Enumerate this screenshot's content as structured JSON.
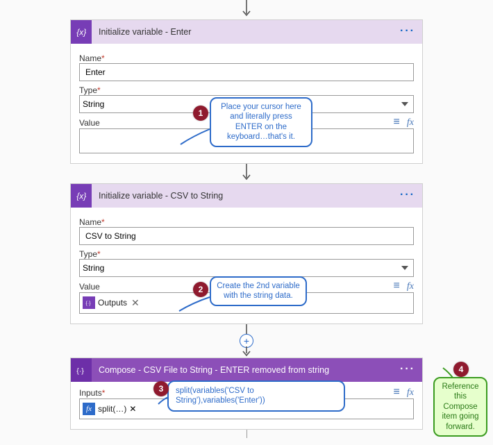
{
  "arrows": {
    "down": "↓"
  },
  "card1": {
    "title": "Initialize variable - Enter",
    "menu": "···",
    "name_label": "Name",
    "name_value": "Enter",
    "type_label": "Type",
    "type_value": "String",
    "value_label": "Value"
  },
  "card2": {
    "title": "Initialize variable - CSV to String",
    "menu": "···",
    "name_label": "Name",
    "name_value": "CSV to String",
    "type_label": "Type",
    "type_value": "String",
    "value_label": "Value",
    "token_label": "Outputs",
    "token_x": "✕"
  },
  "card3": {
    "title": "Compose - CSV File to String - ENTER removed from string",
    "menu": "···",
    "inputs_label": "Inputs",
    "fx_chip": "fx",
    "fx_label": "split(…)",
    "fx_x": "✕"
  },
  "badges": {
    "one": "1",
    "two": "2",
    "three": "3",
    "four": "4"
  },
  "callouts": {
    "c1": "Place your cursor here and literally press ENTER on the keyboard…that's it.",
    "c2": "Create the 2nd variable with the string data.",
    "c3": "split(variables('CSV  to  String'),variables('Enter'))",
    "c4": "Reference this Compose item going forward."
  },
  "chart_data": null
}
